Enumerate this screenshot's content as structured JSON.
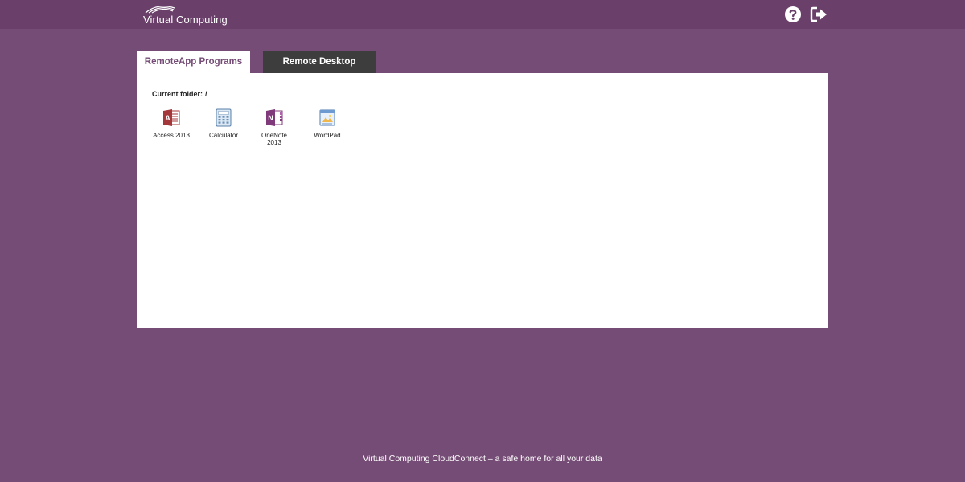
{
  "header": {
    "logo_text": "Virtual Computing",
    "icons": [
      "help-icon",
      "logout-icon"
    ]
  },
  "tabs": [
    {
      "label": "RemoteApp Programs",
      "active": true
    },
    {
      "label": "Remote Desktop",
      "active": false
    }
  ],
  "panel": {
    "current_folder_label": "Current folder:",
    "current_folder_value": "/",
    "apps": [
      {
        "label": "Access 2013",
        "icon": "access-icon"
      },
      {
        "label": "Calculator",
        "icon": "calculator-icon"
      },
      {
        "label": "OneNote 2013",
        "icon": "onenote-icon"
      },
      {
        "label": "WordPad",
        "icon": "wordpad-icon"
      }
    ]
  },
  "footer": {
    "text": "Virtual Computing CloudConnect  – a safe home for all your data"
  },
  "colors": {
    "background": "#754c75",
    "topbar": "#6a406a",
    "active_tab_text": "#754c75",
    "inactive_tab": "#3d3d3d"
  }
}
